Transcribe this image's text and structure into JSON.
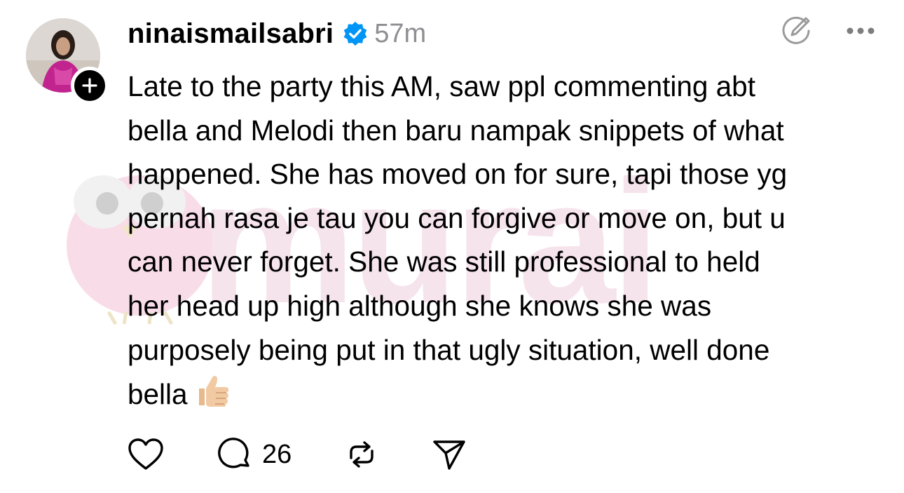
{
  "post": {
    "username": "ninaismailsabri",
    "verified": true,
    "timestamp": "57m",
    "text": "Late to the party this AM, saw ppl commenting abt\nbella and Melodi then baru nampak snippets of what\nhappened. She has moved on for sure, tapi those yg\npernah rasa je tau you can forgive or move on, but u\ncan never forget. She was still professional to held\nher head up high although she knows she was\npurposely being put in that ugly situation, well done\nbella",
    "emoji": "thumbs-up",
    "reply_count": "26"
  },
  "watermark": {
    "text": "murai"
  },
  "icons": {
    "verified": "verified-badge-icon",
    "edit": "edit-icon",
    "more": "more-options-icon",
    "like": "heart-icon",
    "reply": "comment-icon",
    "repost": "repost-icon",
    "share": "share-icon",
    "follow": "plus-icon"
  },
  "colors": {
    "verified_blue": "#0095f6",
    "muted_gray": "#8e8e93",
    "watermark_pink": "#f6e4ec"
  }
}
